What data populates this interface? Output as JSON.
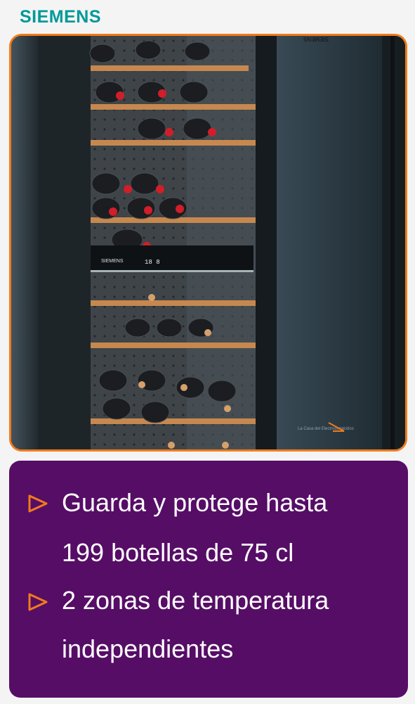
{
  "brand": {
    "logo_text": "SIEMENS"
  },
  "product_image": {
    "fridge_logo_text": "SIEMENS",
    "display_readout": "18 8",
    "watermark": "La Casa del Electrodoméstico",
    "bottle_caps_colors": [
      "#d11e2a",
      "#d6a06a"
    ]
  },
  "features": [
    {
      "icon": "triangle-play-outline-icon",
      "lines": [
        "Guarda y protege hasta",
        "199 botellas de 75 cl"
      ]
    },
    {
      "icon": "triangle-play-outline-icon",
      "lines": [
        "2 zonas de temperatura",
        "independientes"
      ]
    }
  ],
  "colors": {
    "brand": "#009999",
    "accent": "#f07b1b",
    "panel": "#560d66"
  }
}
